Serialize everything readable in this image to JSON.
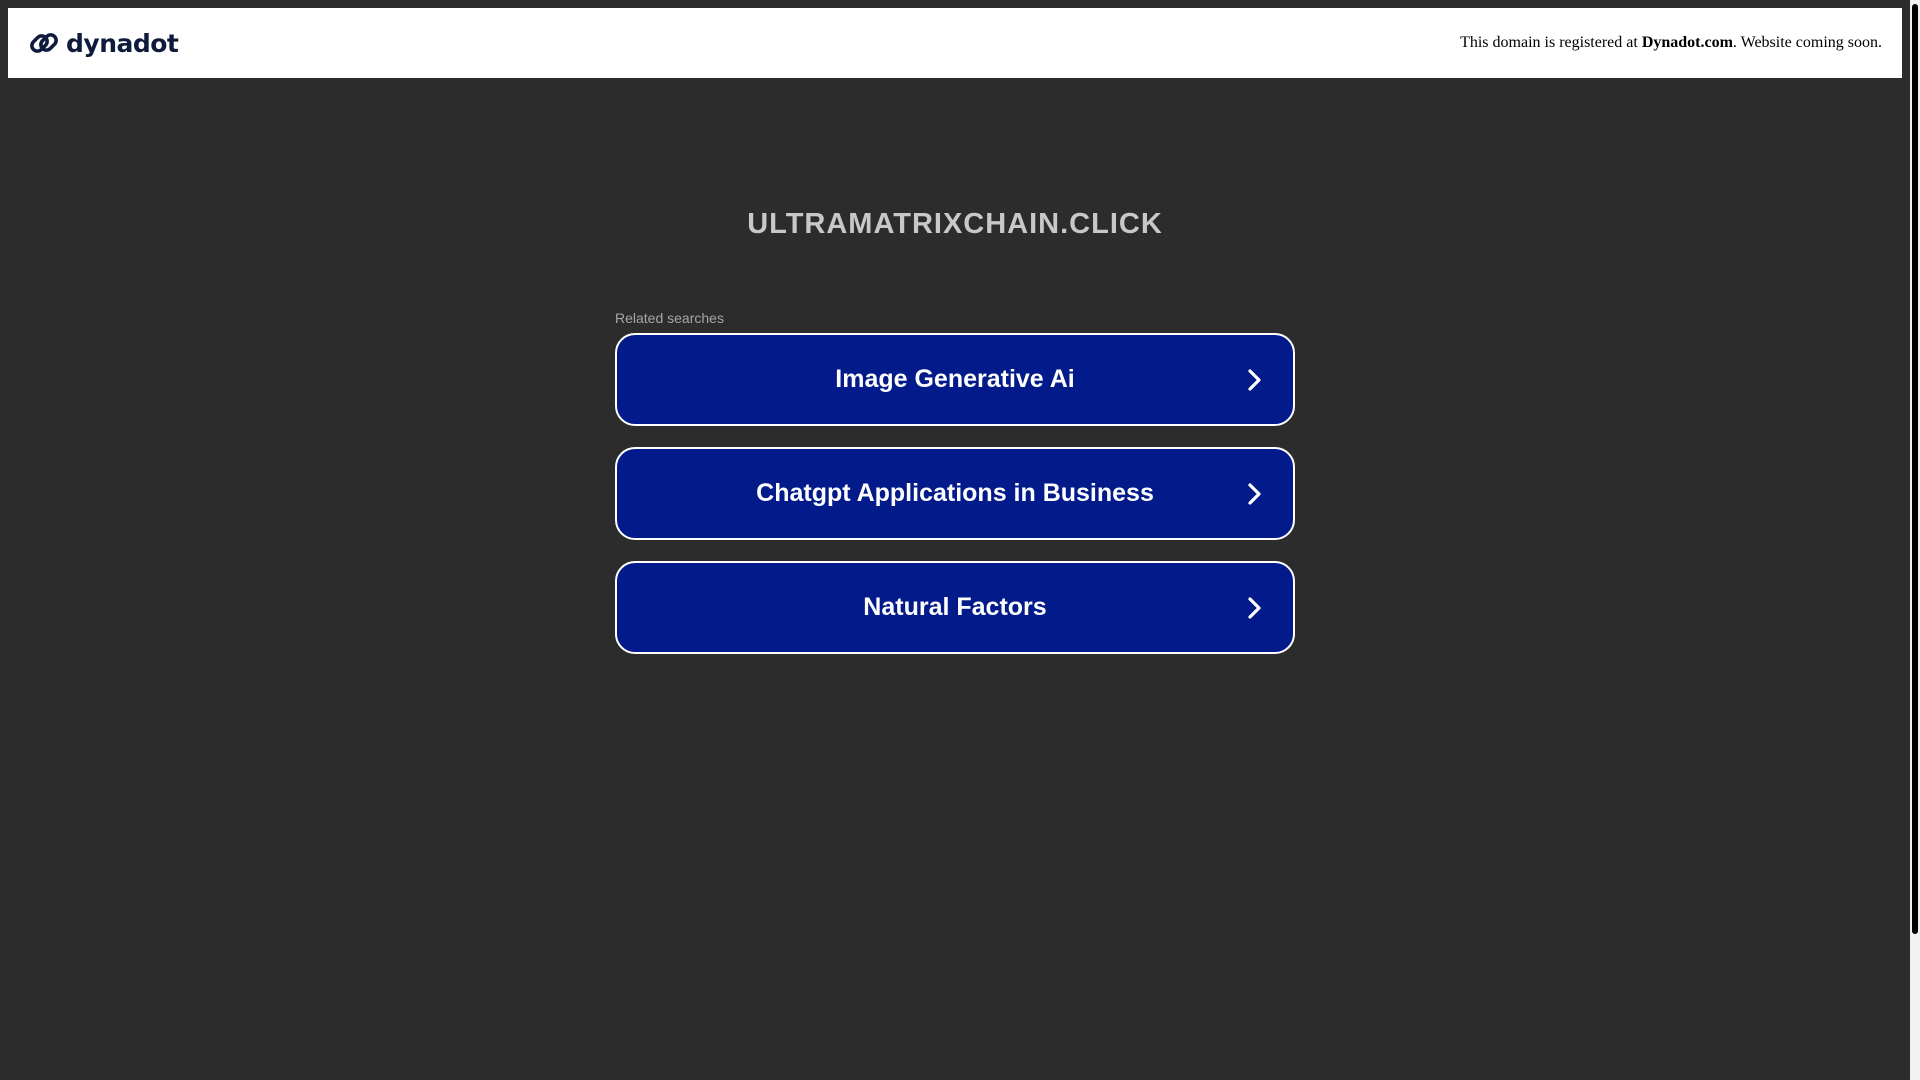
{
  "header": {
    "logo_text": "dynadot",
    "notice_prefix": "This domain is registered at ",
    "notice_link": "Dynadot.com",
    "notice_suffix": ". Website coming soon."
  },
  "main": {
    "domain": "ULTRAMATRIXCHAIN.CLICK",
    "related_label": "Related searches",
    "searches": [
      {
        "label": "Image Generative Ai"
      },
      {
        "label": "Chatgpt Applications in Business"
      },
      {
        "label": "Natural Factors"
      }
    ]
  },
  "colors": {
    "background": "#2c2c2c",
    "button_bg": "#031b8a",
    "button_border": "#ffffff",
    "title": "#c8c8c8",
    "logo": "#0f1b3d"
  },
  "icons": {
    "logo": "dynadot-link-icon",
    "button_arrow": "chevron-right-icon"
  }
}
